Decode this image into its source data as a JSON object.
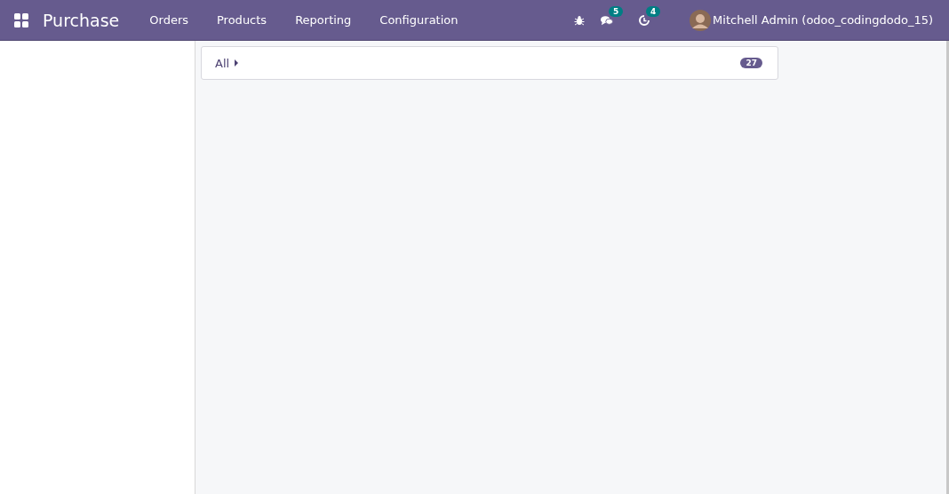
{
  "navbar": {
    "app_name": "Purchase",
    "menu": [
      "Orders",
      "Products",
      "Reporting",
      "Configuration"
    ],
    "messages_count": "5",
    "activities_count": "4",
    "user": "Mitchell Admin (odoo_codingdodo_15)"
  },
  "group": {
    "label": "All",
    "count": "27"
  }
}
